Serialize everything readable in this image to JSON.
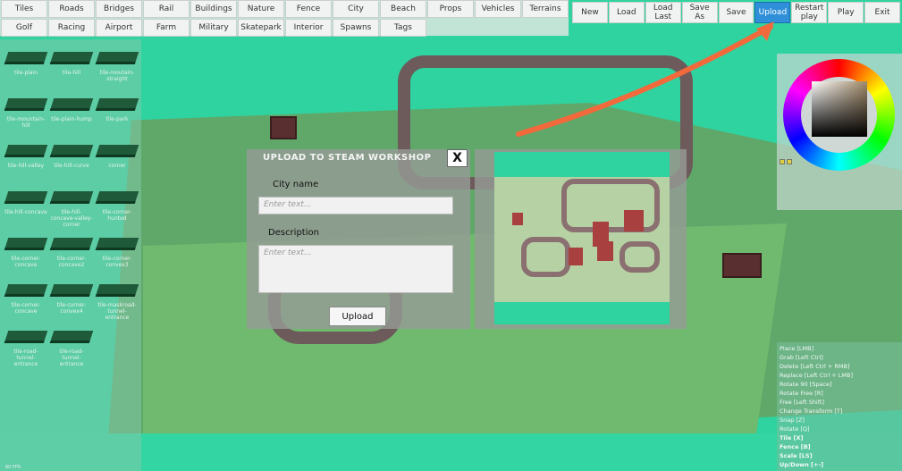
{
  "categories_row1": [
    "Tiles",
    "Roads",
    "Bridges",
    "Rail",
    "Buildings",
    "Nature",
    "Fence",
    "City",
    "Beach",
    "Props",
    "Vehicles",
    "Terrains"
  ],
  "categories_row2": [
    "Golf",
    "Racing",
    "Airport",
    "Farm",
    "Military",
    "Skatepark",
    "Interior",
    "Spawns",
    "Tags"
  ],
  "actions": [
    {
      "label": "New"
    },
    {
      "label": "Load"
    },
    {
      "label": "Load Last"
    },
    {
      "label": "Save As"
    },
    {
      "label": "Save"
    },
    {
      "label": "Upload",
      "active": true
    },
    {
      "label": "Restart play"
    },
    {
      "label": "Play"
    },
    {
      "label": "Exit"
    }
  ],
  "tiles": [
    "tile-plain",
    "tile-hill",
    "tile-moutain-straight",
    "tile-mountain-hill",
    "tile-plain-hump",
    "tile-park",
    "tile-hill-valley",
    "tile-hill-curve",
    "corner",
    "tile-hill-concave",
    "tile-hill-concave-valley-corner",
    "tile-corner-hunted",
    "tile-corner-concave",
    "tile-corner-concave2",
    "tile-corner-convex3",
    "tile-corner-concave",
    "tile-corner-convex4",
    "tile-maskroad-tunnel-entrance",
    "tile-road-tunnel-entrance",
    "tile-road-tunnel-entrance"
  ],
  "modal": {
    "title": "UPLOAD TO STEAM WORKSHOP",
    "close": "X",
    "city_label": "City name",
    "city_placeholder": "Enter text...",
    "desc_label": "Description",
    "desc_placeholder": "Enter text...",
    "upload": "Upload"
  },
  "keybindings": [
    "Place [LMB]",
    "Grab [Left Ctrl]",
    "Delete [Left Ctrl + RMB]",
    "Replace [Left Ctrl + LMB]",
    "Rotate 90 [Space]",
    "Rotate Free [R]",
    "Free [Left Shift]",
    "Change Transform [T]",
    "Snap [Z]",
    "Rotate [Q]",
    "Tile [X]",
    "Fence [B]",
    "Scale [LS]",
    "Up/Down [+-]"
  ],
  "fps": "60 FPS",
  "colors": {
    "accent": "#2f8fd8",
    "arrow": "#f26a3c",
    "background": "#2fd3a0"
  }
}
